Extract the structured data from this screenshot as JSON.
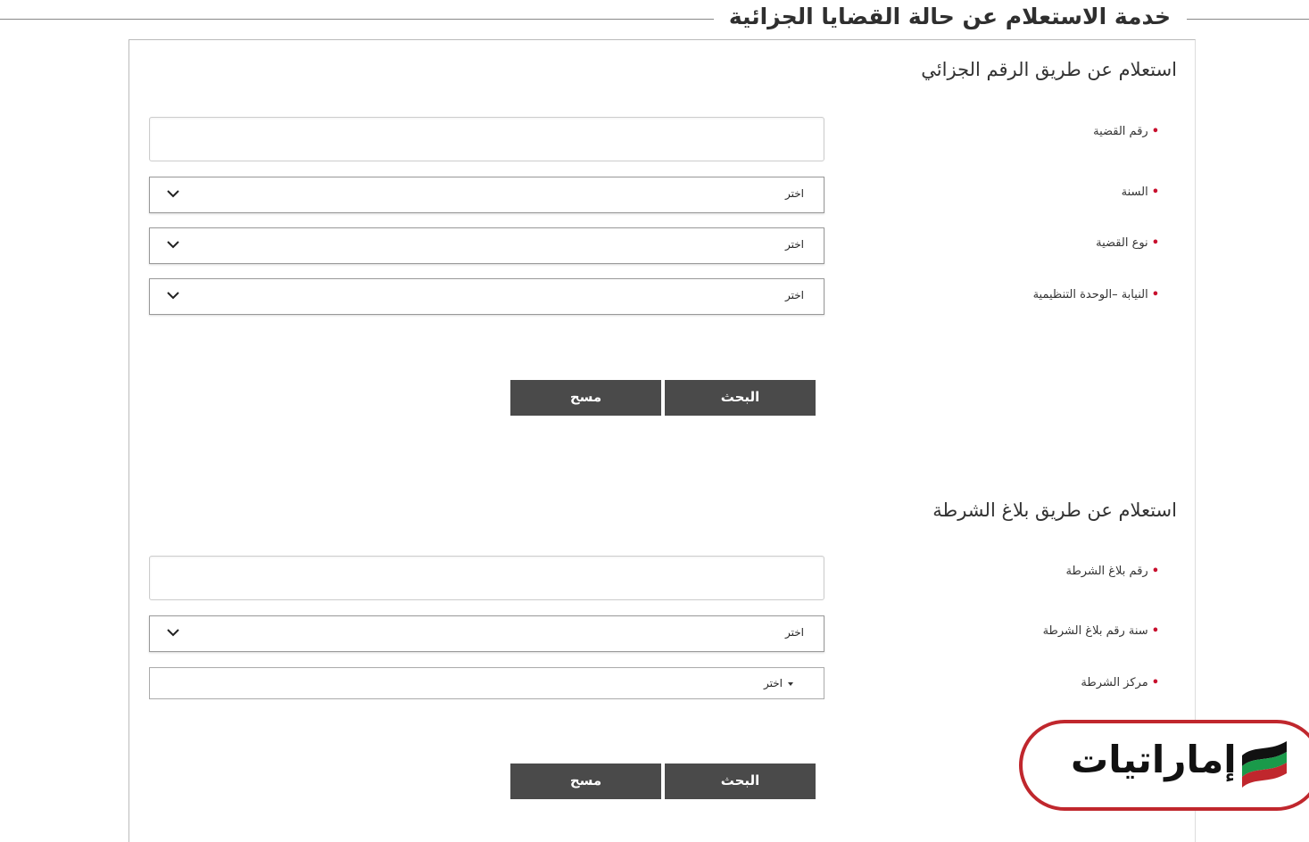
{
  "page": {
    "title": "خدمة الاستعلام عن حالة القضايا الجزائية"
  },
  "section1": {
    "heading": "استعلام عن طريق الرقم الجزائي",
    "fields": [
      {
        "label": "رقم القضية",
        "type": "text",
        "value": ""
      },
      {
        "label": "السنة",
        "type": "select",
        "value": "اختر"
      },
      {
        "label": "نوع القضية",
        "type": "select",
        "value": "اختر"
      },
      {
        "label": "النيابة –الوحدة التنظيمية",
        "type": "select",
        "value": "اختر"
      }
    ],
    "search_label": "البحث",
    "clear_label": "مسح"
  },
  "section2": {
    "heading": "استعلام عن طريق بلاغ الشرطة",
    "fields": [
      {
        "label": "رقم بلاغ الشرطة",
        "type": "text",
        "value": ""
      },
      {
        "label": "سنة رقم بلاغ الشرطة",
        "type": "select",
        "value": "اختر"
      },
      {
        "label": "مركز الشرطة",
        "type": "select",
        "value": "اختر"
      }
    ],
    "search_label": "البحث",
    "clear_label": "مسح"
  },
  "watermark": {
    "text": "إماراتيات",
    "icon": "uae-flag-icon"
  },
  "required_marker": "•",
  "colors": {
    "button_bg": "#4a4a4a",
    "required": "#c8102e",
    "logo_border": "#c0272d"
  }
}
